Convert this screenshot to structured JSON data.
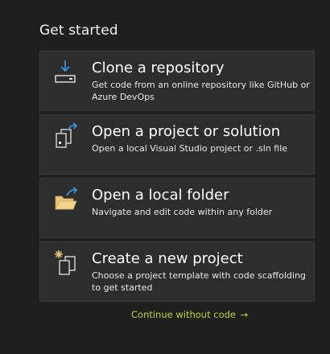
{
  "heading": "Get started",
  "cards": [
    {
      "title": "Clone a repository",
      "description": "Get code from an online repository like GitHub or Azure DevOps",
      "icon": "clone-download-icon"
    },
    {
      "title": "Open a project or solution",
      "description": "Open a local Visual Studio project or .sln file",
      "icon": "open-project-icon"
    },
    {
      "title": "Open a local folder",
      "description": "Navigate and edit code within any folder",
      "icon": "open-folder-icon"
    },
    {
      "title": "Create a new project",
      "description": "Choose a project template with code scaffolding to get started",
      "icon": "new-project-icon"
    }
  ],
  "continue_link": {
    "label": "Continue without code",
    "arrow": "→"
  },
  "colors": {
    "background": "#1f1f1f",
    "card_background": "#2d2d2d",
    "link": "#b8d432",
    "folder": "#e8c77a",
    "accent_blue": "#3c9be8"
  }
}
